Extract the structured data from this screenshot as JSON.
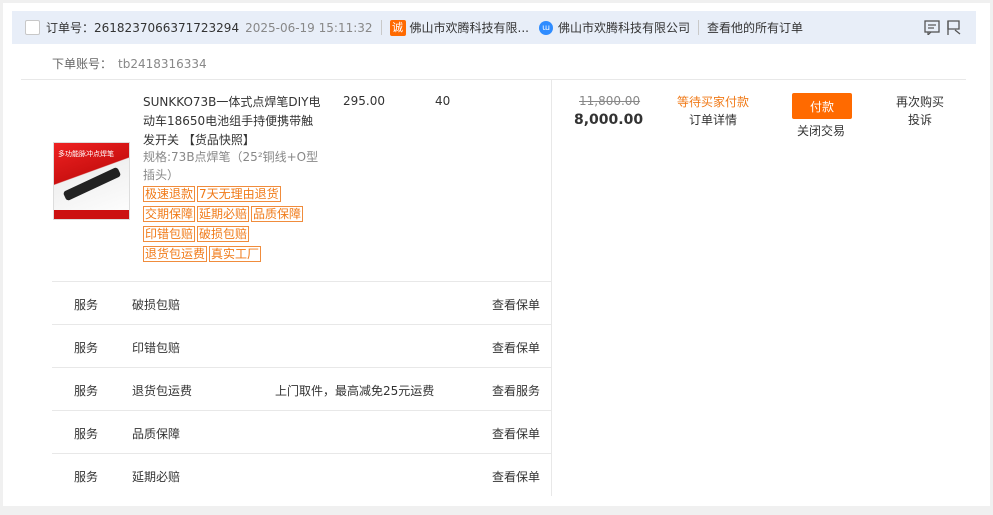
{
  "header": {
    "order_label": "订单号：",
    "order_no": "2618237066371723294",
    "order_date": "2025-06-19 15:11:32",
    "shop_icon_text": "诚",
    "shop_name_truncated": "佛山市欢腾科技有限...",
    "wangwang_icon_text": "ɯ",
    "seller_name": "佛山市欢腾科技有限公司",
    "view_all_orders": "查看他的所有订单",
    "icons": [
      "note-icon",
      "flag-icon"
    ]
  },
  "account": {
    "label": "下单账号：",
    "value": "tb2418316334"
  },
  "item": {
    "thumb_text": "多功能脉冲点焊笔",
    "title": "SUNKKO73B一体式点焊笔DIY电动车18650电池组手持便携带触发开关 【货品快照】",
    "spec": "规格:73B点焊笔（25²铜线+O型插头）",
    "unit_price": "295.00",
    "quantity": "40",
    "tags": [
      "极速退款",
      "7天无理由退货",
      "交期保障",
      "延期必赔",
      "品质保障",
      "印错包赔",
      "破损包赔",
      "退货包运费",
      "真实工厂"
    ]
  },
  "services": [
    {
      "type": "服务",
      "name": "破损包赔",
      "desc": "",
      "action": "查看保单"
    },
    {
      "type": "服务",
      "name": "印错包赔",
      "desc": "",
      "action": "查看保单"
    },
    {
      "type": "服务",
      "name": "退货包运费",
      "desc": "上门取件，最高减免25元运费",
      "action": "查看服务"
    },
    {
      "type": "服务",
      "name": "品质保障",
      "desc": "",
      "action": "查看保单"
    },
    {
      "type": "服务",
      "name": "延期必赔",
      "desc": "",
      "action": "查看保单"
    }
  ],
  "payment": {
    "original_total": "11,800.00",
    "actual_total": "8,000.00"
  },
  "status": {
    "text": "等待买家付款",
    "detail": "订单详情"
  },
  "actions": {
    "pay": "付款",
    "close": "关闭交易",
    "rebuy": "再次购买",
    "complain": "投诉"
  },
  "colors": {
    "accent": "#ff6a00",
    "tag": "#f07a18",
    "header_bg": "#e8eef8"
  }
}
